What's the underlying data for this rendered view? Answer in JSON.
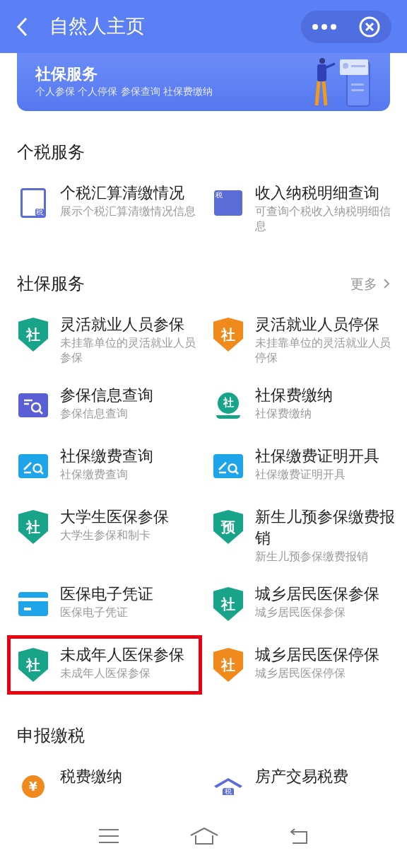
{
  "header": {
    "title": "自然人主页"
  },
  "banner": {
    "title": "社保服务",
    "subtitle": "个人参保 个人停保 参保查询 社保费缴纳"
  },
  "sections": [
    {
      "title": "个税服务",
      "items": [
        {
          "kind": "tax-doc",
          "glyph": "税",
          "color": "#5b6bd8",
          "title": "个税汇算清缴情况",
          "subtitle": "展示个税汇算清缴情况信息",
          "highlighted": false
        },
        {
          "kind": "tax-search",
          "glyph": "税",
          "color": "#5b6bd8",
          "title": "收入纳税明细查询",
          "subtitle": "可查询个税收入纳税明细信息",
          "highlighted": false
        }
      ]
    },
    {
      "title": "社保服务",
      "more": "更多",
      "items": [
        {
          "kind": "shield",
          "glyph": "社",
          "color": "#17a489",
          "title": "灵活就业人员参保",
          "subtitle": "未挂靠单位的灵活就业人员参保",
          "highlighted": false
        },
        {
          "kind": "shield",
          "glyph": "社",
          "color": "#f08a1c",
          "title": "灵活就业人员停保",
          "subtitle": "未挂靠单位的灵活就业人员停保",
          "highlighted": false
        },
        {
          "kind": "search-card",
          "color": "#5b5fd6",
          "title": "参保信息查询",
          "subtitle": "参保信息查询",
          "highlighted": false
        },
        {
          "kind": "coin-wave",
          "glyph": "社",
          "color": "#17a489",
          "title": "社保费缴纳",
          "subtitle": "社保费缴纳",
          "highlighted": false
        },
        {
          "kind": "pen-search",
          "color": "#1ea5e9",
          "title": "社保缴费查询",
          "subtitle": "社保缴费查询",
          "highlighted": false
        },
        {
          "kind": "pen-search",
          "color": "#1ea5e9",
          "title": "社保缴费证明开具",
          "subtitle": "社保缴费证明开具",
          "highlighted": false
        },
        {
          "kind": "shield",
          "glyph": "社",
          "color": "#17a489",
          "title": "大学生医保参保",
          "subtitle": "大学生参保和制卡",
          "highlighted": false
        },
        {
          "kind": "shield",
          "glyph": "预",
          "color": "#17a489",
          "title": "新生儿预参保缴费报销",
          "subtitle": "新生儿预参保缴费报销",
          "highlighted": false
        },
        {
          "kind": "id-card",
          "color": "#1ea5e9",
          "title": "医保电子凭证",
          "subtitle": "医保电子凭证",
          "highlighted": false
        },
        {
          "kind": "shield",
          "glyph": "社",
          "color": "#17a489",
          "title": "城乡居民医保参保",
          "subtitle": "城乡居民医保参保",
          "highlighted": false
        },
        {
          "kind": "shield",
          "glyph": "社",
          "color": "#17a489",
          "title": "未成年人医保参保",
          "subtitle": "未成年人医保参保",
          "highlighted": true
        },
        {
          "kind": "shield",
          "glyph": "社",
          "color": "#f08a1c",
          "title": "城乡居民医保停保",
          "subtitle": "城乡居民医保停保",
          "highlighted": false
        }
      ]
    },
    {
      "title": "申报缴税",
      "items": [
        {
          "kind": "coin",
          "glyph": "¥",
          "color": "#f08a1c",
          "title": "税费缴纳",
          "highlighted": false
        },
        {
          "kind": "house",
          "glyph": "税",
          "color": "#5b6bd8",
          "title": "房产交易税费",
          "highlighted": false
        }
      ]
    }
  ]
}
